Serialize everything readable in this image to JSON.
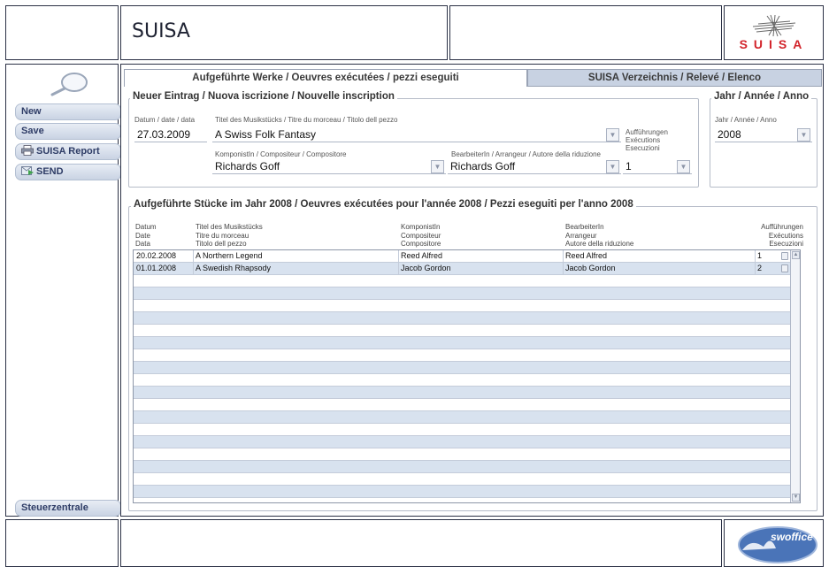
{
  "header": {
    "title": "SUISA",
    "logo_text": "SUISA"
  },
  "sidebar": {
    "search_icon": "magnifier-icon",
    "buttons": [
      {
        "label": "New",
        "icon": ""
      },
      {
        "label": "Save",
        "icon": ""
      },
      {
        "label": "SUISA Report",
        "icon": "printer-icon"
      },
      {
        "label": "SEND",
        "icon": "send-icon"
      }
    ],
    "footer_button": "Steuerzentrale"
  },
  "tabs": [
    {
      "label": "Aufgeführte Werke / Oeuvres exécutées / pezzi eseguiti",
      "active": true
    },
    {
      "label": "SUISA Verzeichnis / Relevé / Elenco",
      "active": false
    }
  ],
  "new_entry": {
    "legend": "Neuer Eintrag / Nuova iscrizione / Nouvelle inscription",
    "date_label": "Datum / date / data",
    "date_value": "27.03.2009",
    "title_label": "Titel des Musikstücks / Titre du morceau / Titolo dell pezzo",
    "title_value": "A Swiss Folk Fantasy",
    "performances_label_1": "Aufführungen",
    "performances_label_2": "Exécutions",
    "performances_label_3": "Esecuzioni",
    "performances_value": "1",
    "composer_label": "KomponistIn / Compositeur / Compositore",
    "composer_value": "Richards Goff",
    "arranger_label": "BearbeiterIn / Arrangeur / Autore della riduzione",
    "arranger_value": "Richards Goff"
  },
  "year_box": {
    "legend": "Jahr / Année / Anno",
    "label": "Jahr / Année / Anno",
    "value": "2008"
  },
  "performed": {
    "legend": "Aufgeführte Stücke im Jahr 2008 / Oeuvres exécutées pour l'année 2008 / Pezzi eseguiti per l'anno 2008",
    "headers": {
      "date": [
        "Datum",
        "Date",
        "Data"
      ],
      "title": [
        "Titel des Musikstücks",
        "Titre du morceau",
        "Titolo dell pezzo"
      ],
      "composer": [
        "KomponistIn",
        "Compositeur",
        "Compositore"
      ],
      "arranger": [
        "BearbeiterIn",
        "Arrangeur",
        "Autore della riduzione"
      ],
      "count": [
        "Aufführungen",
        "Exécutions",
        "Esecuzioni"
      ]
    },
    "rows": [
      {
        "date": "20.02.2008",
        "title": "A Northern Legend",
        "composer": "Reed Alfred",
        "arranger": "Reed Alfred",
        "count": "1"
      },
      {
        "date": "01.01.2008",
        "title": "A Swedish Rhapsody",
        "composer": "Jacob Gordon",
        "arranger": "Jacob Gordon",
        "count": "2"
      }
    ]
  },
  "footer": {
    "logo_text": "swoffice"
  },
  "colors": {
    "frame": "#2b3145",
    "brand_red": "#d2232a",
    "alt_row": "#d8e2ef",
    "button_text": "#2e3c66"
  }
}
